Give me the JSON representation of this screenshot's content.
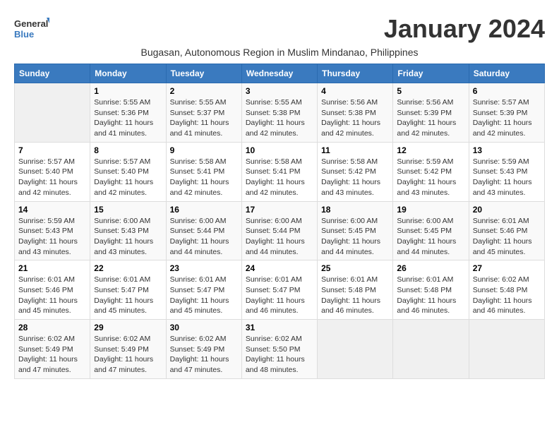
{
  "logo": {
    "general": "General",
    "blue": "Blue"
  },
  "title": "January 2024",
  "subtitle": "Bugasan, Autonomous Region in Muslim Mindanao, Philippines",
  "days_of_week": [
    "Sunday",
    "Monday",
    "Tuesday",
    "Wednesday",
    "Thursday",
    "Friday",
    "Saturday"
  ],
  "weeks": [
    [
      {
        "day": "",
        "sunrise": "",
        "sunset": "",
        "daylight": "",
        "empty": true
      },
      {
        "day": "1",
        "sunrise": "Sunrise: 5:55 AM",
        "sunset": "Sunset: 5:36 PM",
        "daylight": "Daylight: 11 hours and 41 minutes."
      },
      {
        "day": "2",
        "sunrise": "Sunrise: 5:55 AM",
        "sunset": "Sunset: 5:37 PM",
        "daylight": "Daylight: 11 hours and 41 minutes."
      },
      {
        "day": "3",
        "sunrise": "Sunrise: 5:55 AM",
        "sunset": "Sunset: 5:38 PM",
        "daylight": "Daylight: 11 hours and 42 minutes."
      },
      {
        "day": "4",
        "sunrise": "Sunrise: 5:56 AM",
        "sunset": "Sunset: 5:38 PM",
        "daylight": "Daylight: 11 hours and 42 minutes."
      },
      {
        "day": "5",
        "sunrise": "Sunrise: 5:56 AM",
        "sunset": "Sunset: 5:39 PM",
        "daylight": "Daylight: 11 hours and 42 minutes."
      },
      {
        "day": "6",
        "sunrise": "Sunrise: 5:57 AM",
        "sunset": "Sunset: 5:39 PM",
        "daylight": "Daylight: 11 hours and 42 minutes."
      }
    ],
    [
      {
        "day": "7",
        "sunrise": "Sunrise: 5:57 AM",
        "sunset": "Sunset: 5:40 PM",
        "daylight": "Daylight: 11 hours and 42 minutes."
      },
      {
        "day": "8",
        "sunrise": "Sunrise: 5:57 AM",
        "sunset": "Sunset: 5:40 PM",
        "daylight": "Daylight: 11 hours and 42 minutes."
      },
      {
        "day": "9",
        "sunrise": "Sunrise: 5:58 AM",
        "sunset": "Sunset: 5:41 PM",
        "daylight": "Daylight: 11 hours and 42 minutes."
      },
      {
        "day": "10",
        "sunrise": "Sunrise: 5:58 AM",
        "sunset": "Sunset: 5:41 PM",
        "daylight": "Daylight: 11 hours and 42 minutes."
      },
      {
        "day": "11",
        "sunrise": "Sunrise: 5:58 AM",
        "sunset": "Sunset: 5:42 PM",
        "daylight": "Daylight: 11 hours and 43 minutes."
      },
      {
        "day": "12",
        "sunrise": "Sunrise: 5:59 AM",
        "sunset": "Sunset: 5:42 PM",
        "daylight": "Daylight: 11 hours and 43 minutes."
      },
      {
        "day": "13",
        "sunrise": "Sunrise: 5:59 AM",
        "sunset": "Sunset: 5:43 PM",
        "daylight": "Daylight: 11 hours and 43 minutes."
      }
    ],
    [
      {
        "day": "14",
        "sunrise": "Sunrise: 5:59 AM",
        "sunset": "Sunset: 5:43 PM",
        "daylight": "Daylight: 11 hours and 43 minutes."
      },
      {
        "day": "15",
        "sunrise": "Sunrise: 6:00 AM",
        "sunset": "Sunset: 5:43 PM",
        "daylight": "Daylight: 11 hours and 43 minutes."
      },
      {
        "day": "16",
        "sunrise": "Sunrise: 6:00 AM",
        "sunset": "Sunset: 5:44 PM",
        "daylight": "Daylight: 11 hours and 44 minutes."
      },
      {
        "day": "17",
        "sunrise": "Sunrise: 6:00 AM",
        "sunset": "Sunset: 5:44 PM",
        "daylight": "Daylight: 11 hours and 44 minutes."
      },
      {
        "day": "18",
        "sunrise": "Sunrise: 6:00 AM",
        "sunset": "Sunset: 5:45 PM",
        "daylight": "Daylight: 11 hours and 44 minutes."
      },
      {
        "day": "19",
        "sunrise": "Sunrise: 6:00 AM",
        "sunset": "Sunset: 5:45 PM",
        "daylight": "Daylight: 11 hours and 44 minutes."
      },
      {
        "day": "20",
        "sunrise": "Sunrise: 6:01 AM",
        "sunset": "Sunset: 5:46 PM",
        "daylight": "Daylight: 11 hours and 45 minutes."
      }
    ],
    [
      {
        "day": "21",
        "sunrise": "Sunrise: 6:01 AM",
        "sunset": "Sunset: 5:46 PM",
        "daylight": "Daylight: 11 hours and 45 minutes."
      },
      {
        "day": "22",
        "sunrise": "Sunrise: 6:01 AM",
        "sunset": "Sunset: 5:47 PM",
        "daylight": "Daylight: 11 hours and 45 minutes."
      },
      {
        "day": "23",
        "sunrise": "Sunrise: 6:01 AM",
        "sunset": "Sunset: 5:47 PM",
        "daylight": "Daylight: 11 hours and 45 minutes."
      },
      {
        "day": "24",
        "sunrise": "Sunrise: 6:01 AM",
        "sunset": "Sunset: 5:47 PM",
        "daylight": "Daylight: 11 hours and 46 minutes."
      },
      {
        "day": "25",
        "sunrise": "Sunrise: 6:01 AM",
        "sunset": "Sunset: 5:48 PM",
        "daylight": "Daylight: 11 hours and 46 minutes."
      },
      {
        "day": "26",
        "sunrise": "Sunrise: 6:01 AM",
        "sunset": "Sunset: 5:48 PM",
        "daylight": "Daylight: 11 hours and 46 minutes."
      },
      {
        "day": "27",
        "sunrise": "Sunrise: 6:02 AM",
        "sunset": "Sunset: 5:48 PM",
        "daylight": "Daylight: 11 hours and 46 minutes."
      }
    ],
    [
      {
        "day": "28",
        "sunrise": "Sunrise: 6:02 AM",
        "sunset": "Sunset: 5:49 PM",
        "daylight": "Daylight: 11 hours and 47 minutes."
      },
      {
        "day": "29",
        "sunrise": "Sunrise: 6:02 AM",
        "sunset": "Sunset: 5:49 PM",
        "daylight": "Daylight: 11 hours and 47 minutes."
      },
      {
        "day": "30",
        "sunrise": "Sunrise: 6:02 AM",
        "sunset": "Sunset: 5:49 PM",
        "daylight": "Daylight: 11 hours and 47 minutes."
      },
      {
        "day": "31",
        "sunrise": "Sunrise: 6:02 AM",
        "sunset": "Sunset: 5:50 PM",
        "daylight": "Daylight: 11 hours and 48 minutes."
      },
      {
        "day": "",
        "sunrise": "",
        "sunset": "",
        "daylight": "",
        "empty": true
      },
      {
        "day": "",
        "sunrise": "",
        "sunset": "",
        "daylight": "",
        "empty": true
      },
      {
        "day": "",
        "sunrise": "",
        "sunset": "",
        "daylight": "",
        "empty": true
      }
    ]
  ]
}
